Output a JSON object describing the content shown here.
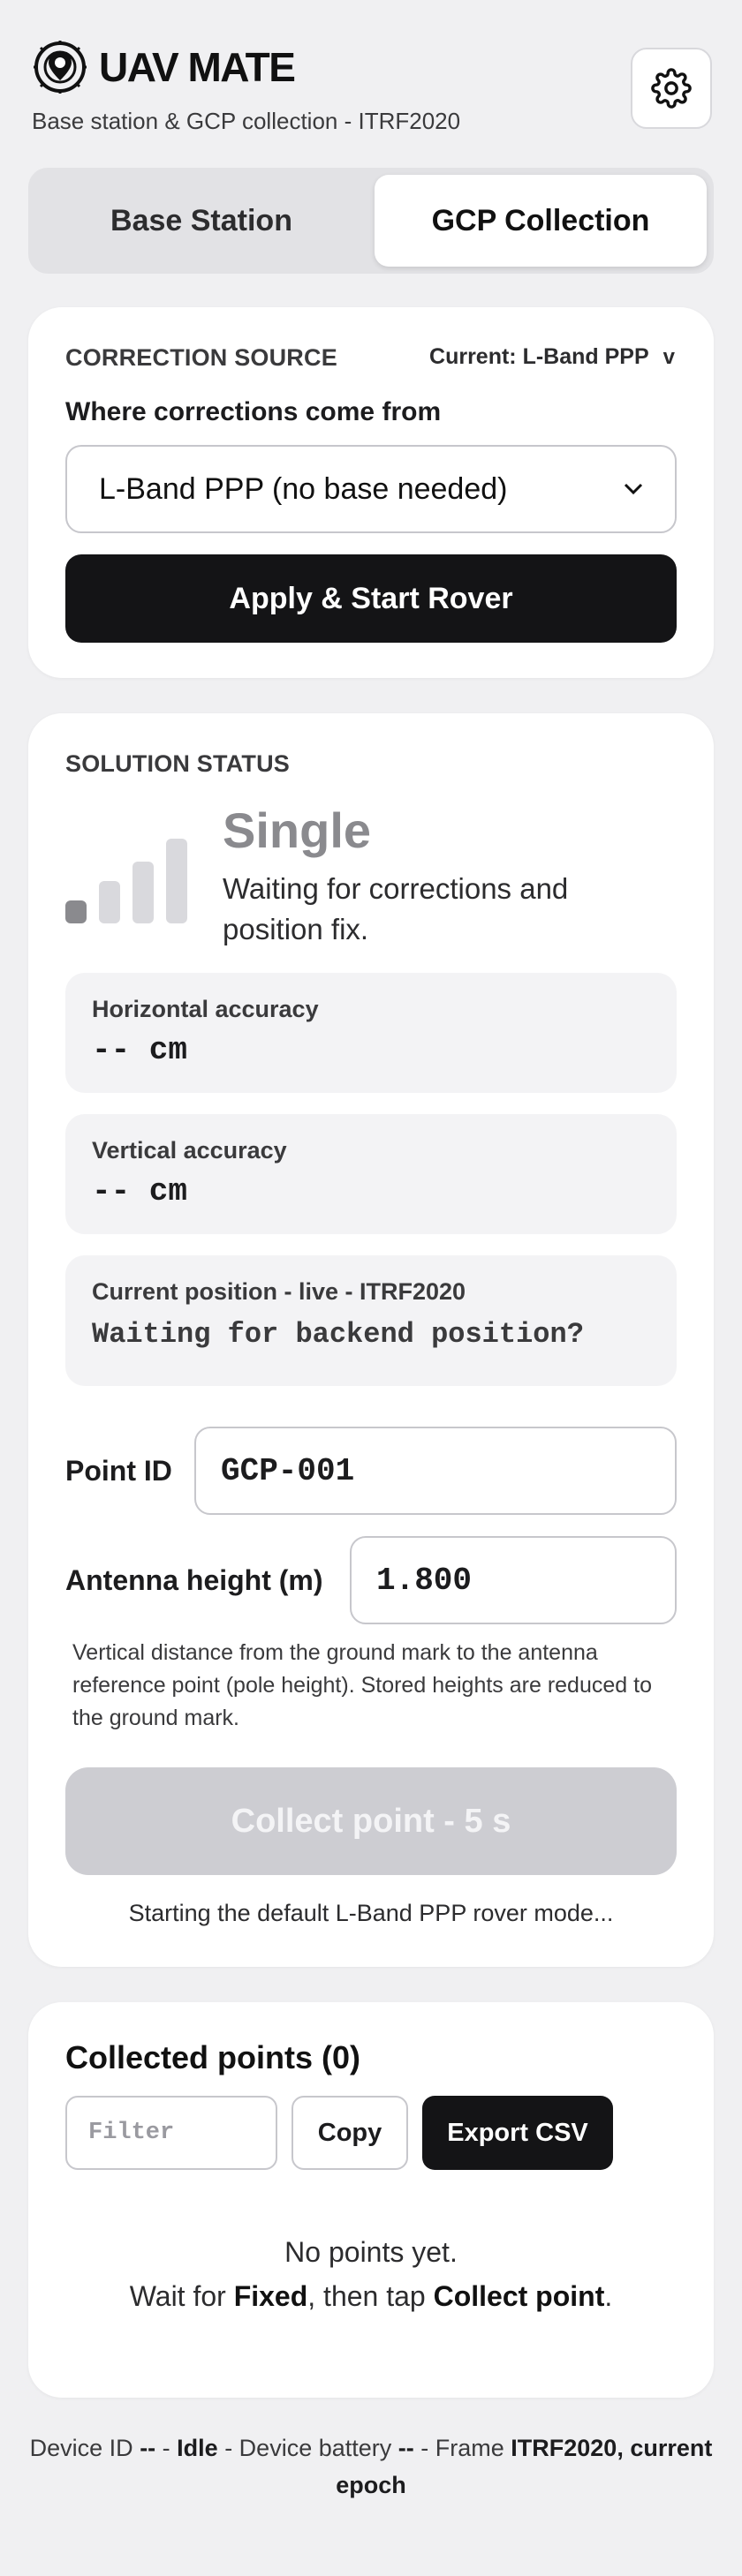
{
  "header": {
    "app_title": "UAV MATE",
    "subtitle": "Base station & GCP collection - ITRF2020"
  },
  "tabs": [
    {
      "label": "Base Station",
      "active": false
    },
    {
      "label": "GCP Collection",
      "active": true
    }
  ],
  "correction": {
    "section_label": "CORRECTION SOURCE",
    "current_label": "Current: L-Band PPP",
    "chevron": "v",
    "field_label": "Where corrections come from",
    "selected_option": "L-Band PPP (no base needed)",
    "apply_button": "Apply & Start Rover"
  },
  "solution": {
    "section_label": "SOLUTION STATUS",
    "status": "Single",
    "description": "Waiting for corrections and position fix.",
    "signal_bars_active": 1,
    "signal_bars_total": 4,
    "horizontal_label": "Horizontal accuracy",
    "horizontal_value": "-- cm",
    "vertical_label": "Vertical accuracy",
    "vertical_value": "-- cm",
    "position_label": "Current position - live - ITRF2020",
    "position_value": "Waiting for backend position?",
    "point_id_label": "Point ID",
    "point_id_value": "GCP-001",
    "antenna_label": "Antenna height (m)",
    "antenna_value": "1.800",
    "help_text": "Vertical distance from the ground mark to the antenna reference point (pole height). Stored heights are reduced to the ground mark.",
    "collect_button": "Collect point - 5 s",
    "status_message": "Starting the default L-Band PPP rover mode..."
  },
  "points": {
    "title": "Collected points (0)",
    "filter_placeholder": "Filter",
    "copy_button": "Copy",
    "export_button": "Export CSV",
    "empty_line1": "No points yet.",
    "empty_line2_a": "Wait for ",
    "empty_line2_b": "Fixed",
    "empty_line2_c": ", then tap ",
    "empty_line2_d": "Collect point",
    "empty_line2_e": "."
  },
  "footer": {
    "device_id_label": "Device ID ",
    "device_id": "--",
    "sep1": " - ",
    "state": "Idle",
    "battery_label": " - Device battery ",
    "battery": "--",
    "frame_label": " - Frame ",
    "frame": "ITRF2020, current epoch"
  },
  "colors": {
    "accent_dark": "#141416",
    "status_gray": "#8a8a8e",
    "bar_active": "#8a8a8e",
    "bar_inactive": "#d9d9dd"
  }
}
